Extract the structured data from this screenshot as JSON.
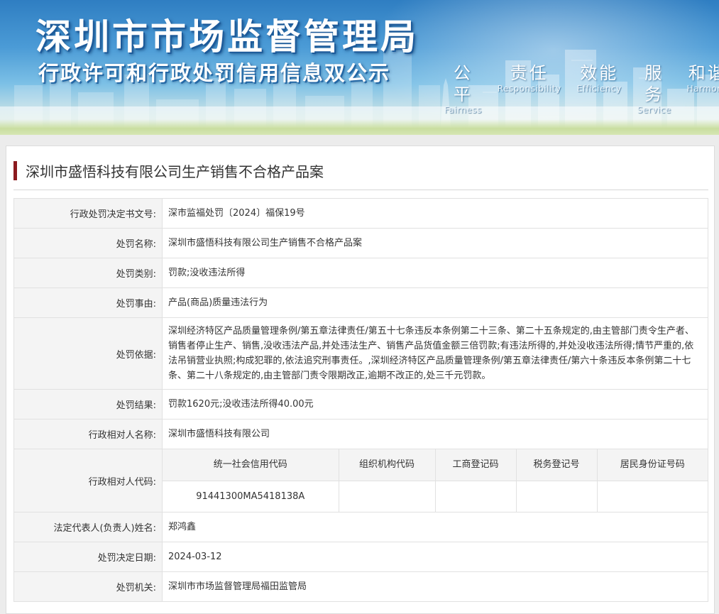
{
  "banner": {
    "title": "深圳市市场监督管理局",
    "subtitle": "行政许可和行政处罚信用信息双公示",
    "slogans": [
      {
        "cn": "公平",
        "en": "Fairness"
      },
      {
        "cn": "责任",
        "en": "Responsibility"
      },
      {
        "cn": "效能",
        "en": "Efficiency"
      },
      {
        "cn": "服务",
        "en": "Service"
      },
      {
        "cn": "和谐",
        "en": "Harmony"
      }
    ]
  },
  "case": {
    "title": "深圳市盛悟科技有限公司生产销售不合格产品案"
  },
  "rows": {
    "doc_no": {
      "label": "行政处罚决定书文号:",
      "value": "深市监福处罚〔2024〕福保19号"
    },
    "name": {
      "label": "处罚名称:",
      "value": "深圳市盛悟科技有限公司生产销售不合格产品案"
    },
    "type": {
      "label": "处罚类别:",
      "value": "罚款;没收违法所得"
    },
    "reason": {
      "label": "处罚事由:",
      "value": "产品(商品)质量违法行为"
    },
    "basis": {
      "label": "处罚依据:",
      "value": "深圳经济特区产品质量管理条例/第五章法律责任/第五十七条违反本条例第二十三条、第二十五条规定的,由主管部门责令生产者、销售者停止生产、销售,没收违法产品,并处违法生产、销售产品货值金额三倍罚款;有违法所得的,并处没收违法所得;情节严重的,依法吊销营业执照;构成犯罪的,依法追究刑事责任。,深圳经济特区产品质量管理条例/第五章法律责任/第六十条违反本条例第二十七条、第二十八条规定的,由主管部门责令限期改正,逾期不改正的,处三千元罚款。"
    },
    "result": {
      "label": "处罚结果:",
      "value": "罚款1620元;没收违法所得40.00元"
    },
    "party": {
      "label": "行政相对人名称:",
      "value": "深圳市盛悟科技有限公司"
    },
    "party_code": {
      "label": "行政相对人代码:",
      "headers": [
        "统一社会信用代码",
        "组织机构代码",
        "工商登记码",
        "税务登记号",
        "居民身份证号码"
      ],
      "values": [
        "91441300MA5418138A",
        "",
        "",
        "",
        ""
      ]
    },
    "legal_rep": {
      "label": "法定代表人(负责人)姓名:",
      "value": "郑鸿鑫"
    },
    "date": {
      "label": "处罚决定日期:",
      "value": "2024-03-12"
    },
    "authority": {
      "label": "处罚机关:",
      "value": "深圳市市场监督管理局福田监管局"
    }
  }
}
